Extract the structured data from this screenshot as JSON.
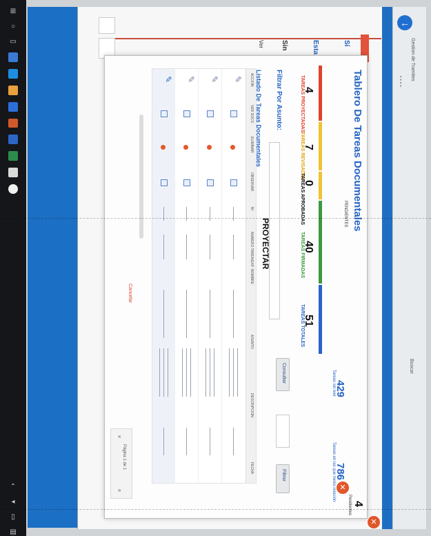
{
  "browser": {
    "back_icon": "arrow-left-icon",
    "tab_label": "Gestion de Tramites",
    "side_button": "Buscar"
  },
  "background_page": {
    "title_prefix": "Sí",
    "left_label": "Sin",
    "section_label": "Esta",
    "link_label": "Ver"
  },
  "modal": {
    "title": "Tablero De Tareas Documentales",
    "pendientes_label": "PENDIENTES",
    "counters": [
      {
        "label": "TAREAS PROYECTADAS",
        "value": "4",
        "color": "#e2412b"
      },
      {
        "label": "TAREAS REVISADAS",
        "value": "7",
        "color": "#f1c232"
      },
      {
        "label": "TAREAS APROBADAS",
        "value": "0",
        "color": "#f1c232"
      },
      {
        "label": "TAREAS FIRMADAS",
        "value": "40",
        "color": "#3c9a3e"
      },
      {
        "label": "TAREAS TOTALES",
        "value": "51",
        "color": "#2b63c9"
      }
    ],
    "stats": [
      {
        "value": "429",
        "label": "Tareas sin leer"
      },
      {
        "value": "786",
        "label": "Tareas en las que tenés relación"
      }
    ],
    "side_count": "4",
    "side_count_label": "Pendientes",
    "filter_label": "Filtrar Por Asunto:",
    "list_title": "Listado De Tareas Documentales",
    "state_badge": "PROYECTAR",
    "consultar_button": "Consultar",
    "filtrar_button": "Filtrar",
    "limpiar_label": "Cancelar",
    "table": {
      "headers": [
        "ACCION",
        "VER DOCS",
        "ELIMINAR",
        "OBSERVAR",
        "Nº",
        "NUMERO TAREA/EXP",
        "NOMBRE",
        "ASUNTO",
        "DESCRIPCION",
        "FECHA"
      ],
      "row_count": 4
    },
    "pager_label": "Página 1 de 1"
  }
}
